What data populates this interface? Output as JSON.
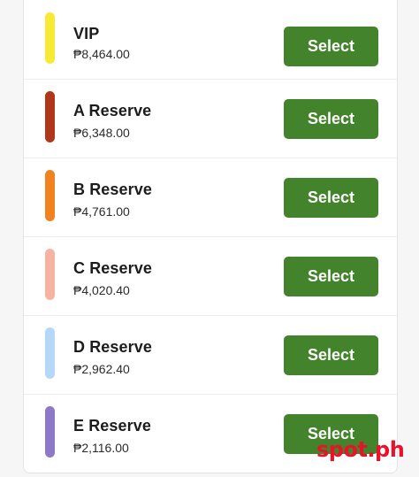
{
  "tiers": [
    {
      "name": "VIP",
      "price": "₱8,464.00",
      "color": "#f6ea34",
      "button_label": "Select"
    },
    {
      "name": "A Reserve",
      "price": "₱6,348.00",
      "color": "#b0371a",
      "button_label": "Select"
    },
    {
      "name": "B Reserve",
      "price": "₱4,761.00",
      "color": "#f08220",
      "button_label": "Select"
    },
    {
      "name": "C Reserve",
      "price": "₱4,020.40",
      "color": "#f7b3a2",
      "button_label": "Select"
    },
    {
      "name": "D Reserve",
      "price": "₱2,962.40",
      "color": "#b4d7fa",
      "button_label": "Select"
    },
    {
      "name": "E Reserve",
      "price": "₱2,116.00",
      "color": "#8e78c9",
      "button_label": "Select"
    }
  ],
  "button_color": "#43832b",
  "watermark": "spot.ph"
}
